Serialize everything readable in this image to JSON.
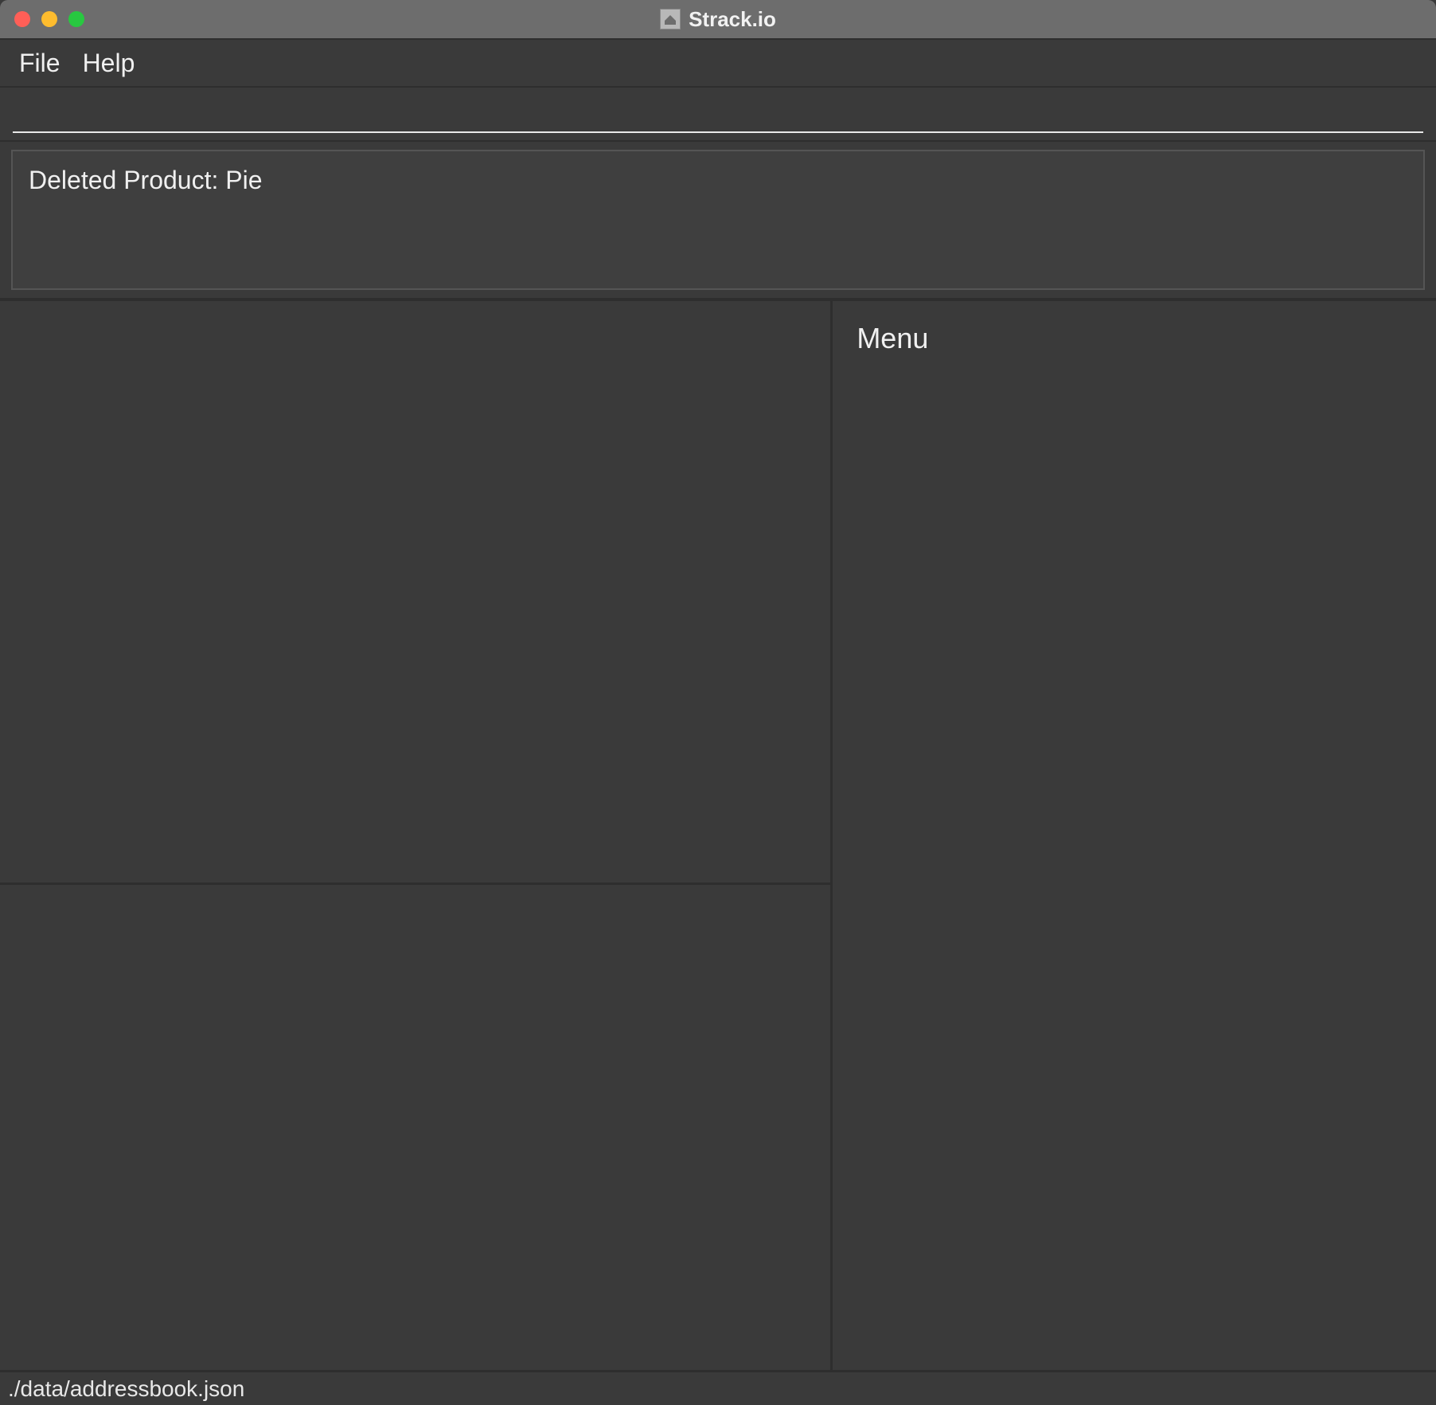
{
  "window": {
    "title": "Strack.io"
  },
  "menubar": {
    "items": [
      {
        "label": "File"
      },
      {
        "label": "Help"
      }
    ]
  },
  "command": {
    "value": "",
    "placeholder": ""
  },
  "message": {
    "text": "Deleted Product: Pie"
  },
  "right_panel": {
    "heading": "Menu"
  },
  "statusbar": {
    "path": "./data/addressbook.json"
  }
}
